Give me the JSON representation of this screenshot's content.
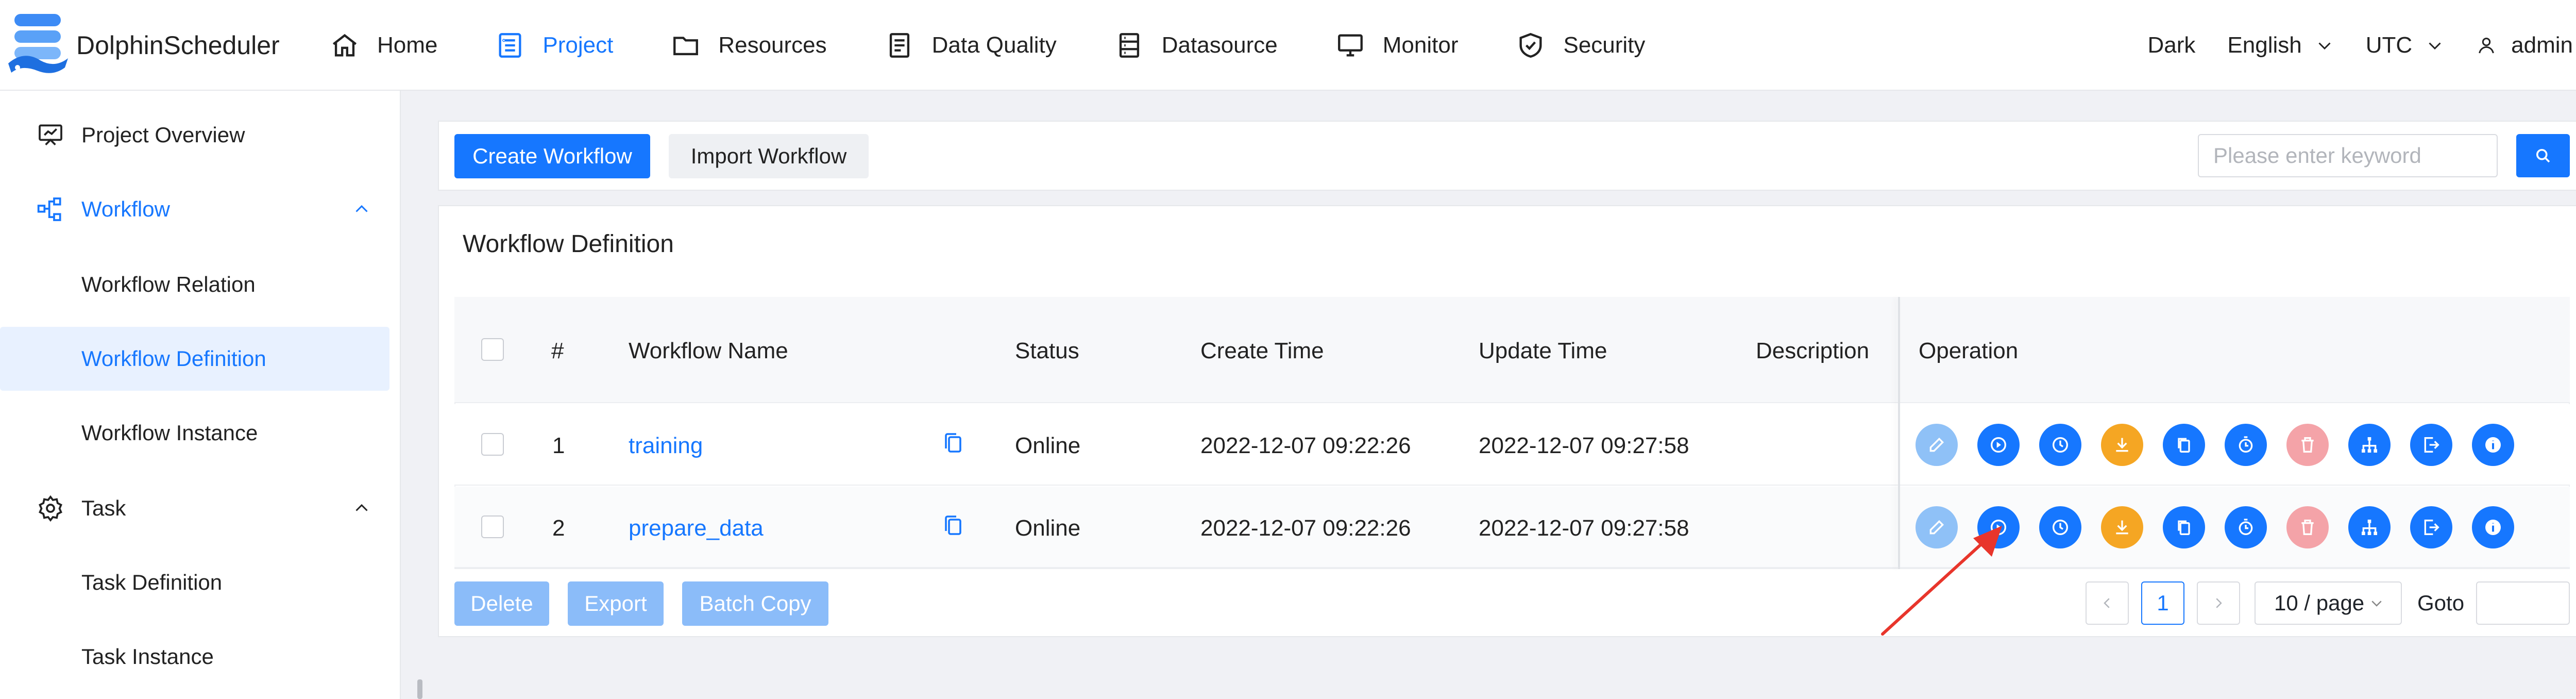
{
  "app": {
    "title": "DolphinScheduler"
  },
  "nav": {
    "items": [
      {
        "label": "Home",
        "icon": "home-icon"
      },
      {
        "label": "Project",
        "icon": "project-icon",
        "active": true
      },
      {
        "label": "Resources",
        "icon": "folder-icon"
      },
      {
        "label": "Data Quality",
        "icon": "document-icon"
      },
      {
        "label": "Datasource",
        "icon": "datasource-icon"
      },
      {
        "label": "Monitor",
        "icon": "monitor-icon"
      },
      {
        "label": "Security",
        "icon": "shield-icon"
      }
    ],
    "theme": "Dark",
    "language": "English",
    "timezone": "UTC",
    "user": "admin"
  },
  "sidebar": {
    "items": [
      {
        "label": "Project Overview",
        "icon": "presentation-icon"
      },
      {
        "label": "Workflow",
        "icon": "workflow-icon",
        "expanded": true
      },
      {
        "label": "Workflow Relation"
      },
      {
        "label": "Workflow Definition",
        "selected": true
      },
      {
        "label": "Workflow Instance"
      },
      {
        "label": "Task",
        "icon": "gear-icon",
        "expanded": true
      },
      {
        "label": "Task Definition"
      },
      {
        "label": "Task Instance"
      }
    ]
  },
  "toolbar": {
    "create_label": "Create Workflow",
    "import_label": "Import Workflow",
    "search_placeholder": "Please enter keyword"
  },
  "main": {
    "title": "Workflow Definition",
    "columns": [
      "#",
      "Workflow Name",
      "Status",
      "Create Time",
      "Update Time",
      "Description",
      "Operation"
    ],
    "rows": [
      {
        "index": "1",
        "name": "training",
        "status": "Online",
        "create_time": "2022-12-07 09:22:26",
        "update_time": "2022-12-07 09:27:58",
        "description": ""
      },
      {
        "index": "2",
        "name": "prepare_data",
        "status": "Online",
        "create_time": "2022-12-07 09:22:26",
        "update_time": "2022-12-07 09:27:58",
        "description": ""
      }
    ],
    "operations": [
      {
        "icon": "edit-icon",
        "color": "#8fc1f7"
      },
      {
        "icon": "play-icon",
        "color": "#1677ff"
      },
      {
        "icon": "clock-icon",
        "color": "#1677ff"
      },
      {
        "icon": "download-icon",
        "color": "#f5a623"
      },
      {
        "icon": "copy-icon",
        "color": "#1677ff"
      },
      {
        "icon": "timer-icon",
        "color": "#1677ff"
      },
      {
        "icon": "trash-icon",
        "color": "#f4a3a8"
      },
      {
        "icon": "tree-icon",
        "color": "#1677ff"
      },
      {
        "icon": "export-icon",
        "color": "#1677ff"
      },
      {
        "icon": "info-icon",
        "color": "#1677ff"
      }
    ],
    "footer": {
      "delete_label": "Delete",
      "export_label": "Export",
      "batch_copy_label": "Batch Copy"
    },
    "pagination": {
      "current_page": "1",
      "page_size": "10 / page",
      "goto_label": "Goto"
    }
  },
  "colors": {
    "primary": "#1677ff",
    "disabled_primary": "#8bbcf9",
    "selected_bg": "#e8f1ff",
    "annotation_arrow": "#e8352b"
  }
}
